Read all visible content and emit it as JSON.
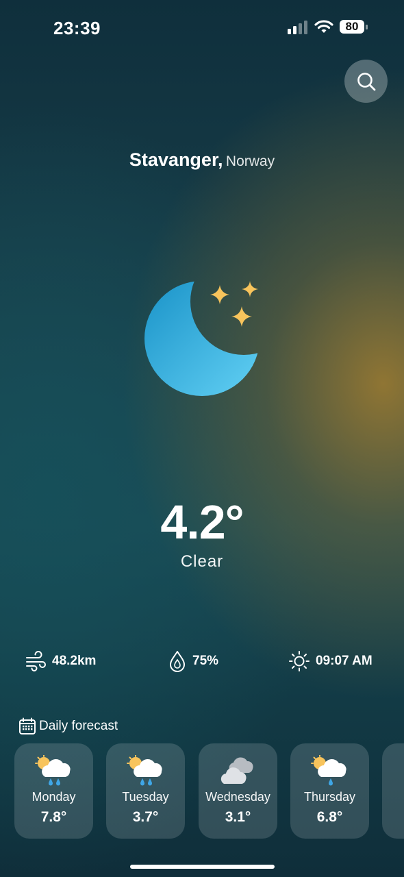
{
  "status_bar": {
    "time": "23:39",
    "battery": "80"
  },
  "search": {
    "icon": "search-icon"
  },
  "location": {
    "city": "Stavanger,",
    "country": "Norway"
  },
  "current": {
    "icon": "moon-stars-icon",
    "temperature": "4.2°",
    "condition": "Clear"
  },
  "stats": {
    "wind": {
      "icon": "wind-icon",
      "value": "48.2km"
    },
    "humidity": {
      "icon": "humidity-icon",
      "value": "75%"
    },
    "sunrise": {
      "icon": "sun-icon",
      "value": "09:07 AM"
    }
  },
  "daily": {
    "title": "Daily forecast",
    "icon": "calendar-icon",
    "days": [
      {
        "day": "Monday",
        "temp": "7.8°",
        "icon": "rain-cloud-sun-icon"
      },
      {
        "day": "Tuesday",
        "temp": "3.7°",
        "icon": "rain-cloud-sun-icon"
      },
      {
        "day": "Wednesday",
        "temp": "3.1°",
        "icon": "cloudy-icon"
      },
      {
        "day": "Thursday",
        "temp": "6.8°",
        "icon": "rain-cloud-sun-icon"
      }
    ]
  },
  "colors": {
    "moon_dark": "#1e9ccf",
    "moon_light": "#5ccbf0",
    "star": "#f8c45c"
  }
}
